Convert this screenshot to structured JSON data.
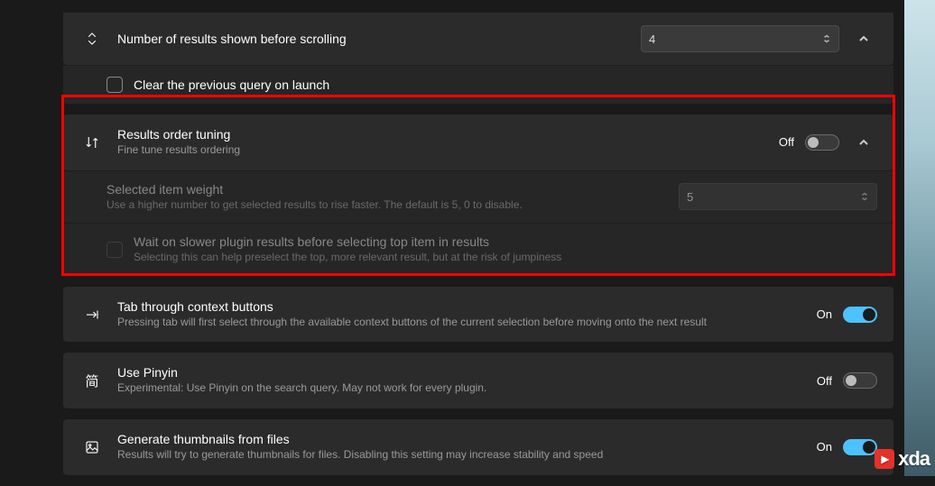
{
  "row_results": {
    "title": "Number of results shown before scrolling",
    "value": "4"
  },
  "row_clear_query": {
    "label": "Clear the previous query on launch"
  },
  "row_order_tuning": {
    "title": "Results order tuning",
    "desc": "Fine tune results ordering",
    "state": "Off"
  },
  "row_selected_weight": {
    "title": "Selected item weight",
    "desc": "Use a higher number to get selected results to rise faster. The default is 5, 0 to disable.",
    "value": "5"
  },
  "row_wait_slow": {
    "title": "Wait on slower plugin results before selecting top item in results",
    "desc": "Selecting this can help preselect the top, more relevant result, but at the risk of jumpiness"
  },
  "row_tab_context": {
    "title": "Tab through context buttons",
    "desc": "Pressing tab will first select through the available context buttons of the current selection before moving onto the next result",
    "state": "On"
  },
  "row_pinyin": {
    "title": "Use Pinyin",
    "desc": "Experimental: Use Pinyin on the search query. May not work for every plugin.",
    "state": "Off"
  },
  "row_thumbnails": {
    "title": "Generate thumbnails from files",
    "desc": "Results will try to generate thumbnails for files. Disabling this setting may increase stability and speed",
    "state": "On"
  },
  "watermark": "xda"
}
